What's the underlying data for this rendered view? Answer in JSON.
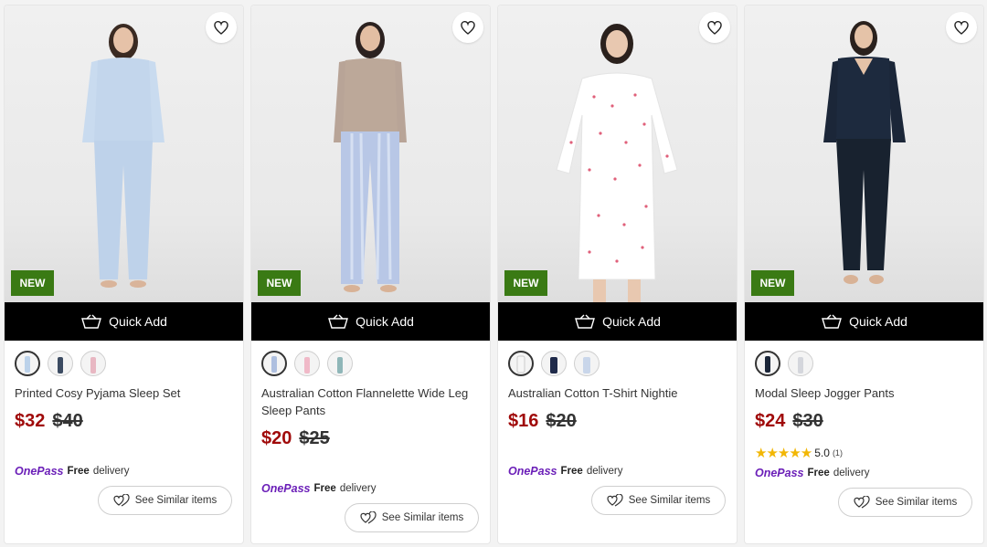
{
  "colors": {
    "new_badge": "#3a7a14",
    "sale_price": "#a00a0a",
    "onepass": "#6b1fb8",
    "quick_add_bg": "#000000"
  },
  "products": [
    {
      "badge": "NEW",
      "quick_add": "Quick Add",
      "name": "Printed Cosy Pyjama Sleep Set",
      "price_now": "$32",
      "price_was": "$40",
      "onepass_logo": "OnePass",
      "onepass_free": "Free",
      "onepass_delivery": "delivery",
      "similar": "See Similar items",
      "swatch_colors": [
        "#bcd2ea",
        "#3c4b62",
        "#e8b7c2"
      ]
    },
    {
      "badge": "NEW",
      "quick_add": "Quick Add",
      "name": "Australian Cotton Flannelette Wide Leg Sleep Pants",
      "price_now": "$20",
      "price_was": "$25",
      "onepass_logo": "OnePass",
      "onepass_free": "Free",
      "onepass_delivery": "delivery",
      "similar": "See Similar items",
      "swatch_colors": [
        "#aebfdf",
        "#f0b9c8",
        "#8fb6b8"
      ]
    },
    {
      "badge": "NEW",
      "quick_add": "Quick Add",
      "name": "Australian Cotton T-Shirt Nightie",
      "price_now": "$16",
      "price_was": "$20",
      "onepass_logo": "OnePass",
      "onepass_free": "Free",
      "onepass_delivery": "delivery",
      "similar": "See Similar items",
      "swatch_colors": [
        "#f6f6f6",
        "#1f2a4a",
        "#c9d6ea"
      ]
    },
    {
      "badge": "NEW",
      "quick_add": "Quick Add",
      "name": "Modal Sleep Jogger Pants",
      "price_now": "$24",
      "price_was": "$30",
      "rating_value": "5.0",
      "rating_count": "(1)",
      "onepass_logo": "OnePass",
      "onepass_free": "Free",
      "onepass_delivery": "delivery",
      "similar": "See Similar items",
      "swatch_colors": [
        "#1a2538",
        "#d4d6dc"
      ]
    }
  ]
}
